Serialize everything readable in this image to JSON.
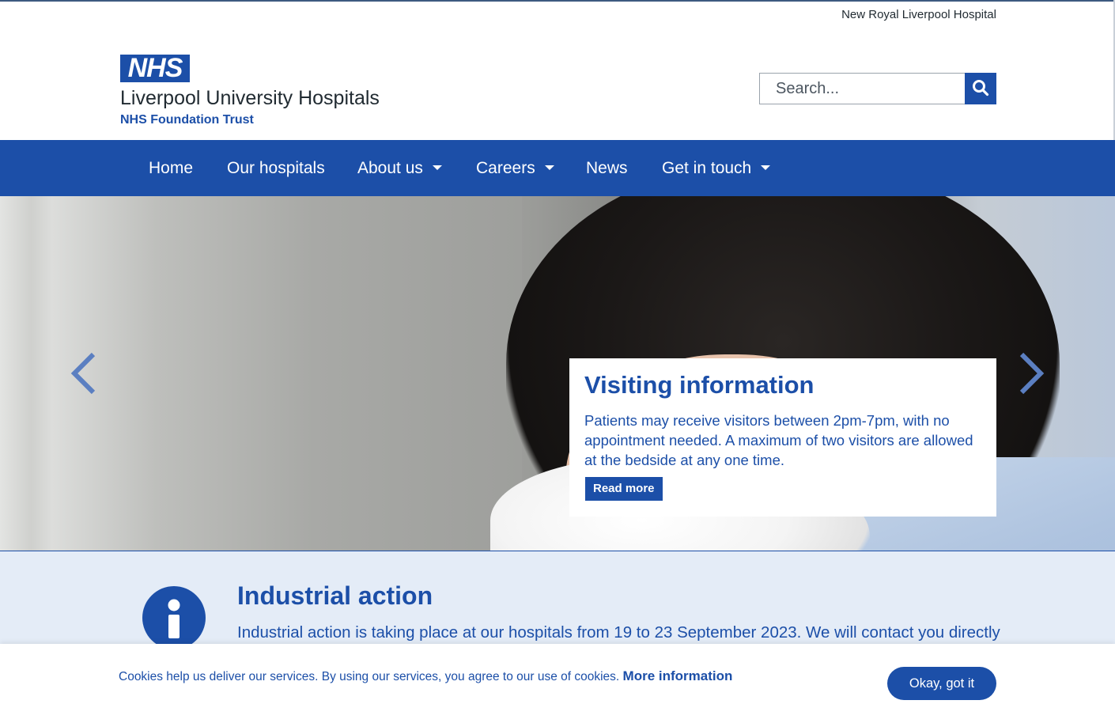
{
  "topbar": {
    "site_link": "New Royal Liverpool Hospital"
  },
  "logo": {
    "nhs": "NHS",
    "name": "Liverpool University Hospitals",
    "sub": "NHS Foundation Trust"
  },
  "search": {
    "placeholder": "Search..."
  },
  "nav": {
    "items": [
      {
        "label": "Home",
        "dropdown": false
      },
      {
        "label": "Our hospitals",
        "dropdown": false
      },
      {
        "label": "About us",
        "dropdown": true
      },
      {
        "label": "Careers",
        "dropdown": true
      },
      {
        "label": "News",
        "dropdown": false
      },
      {
        "label": "Get in touch",
        "dropdown": true
      }
    ]
  },
  "hero": {
    "title": "Visiting information",
    "text": "Patients may receive visitors between 2pm-7pm, with no appointment needed. A maximum of two visitors are allowed at the bedside at any one time.",
    "button": "Read more",
    "image_icon": "woman-sneezing-into-tissue-photo"
  },
  "alert": {
    "icon": "info-icon",
    "title": "Industrial action",
    "text": "Industrial action is taking place at our hospitals from 19 to 23 September 2023. We will contact you directly"
  },
  "cookie": {
    "text": "Cookies help us deliver our services. By using our services, you agree to our use of cookies.",
    "link": "More information",
    "button": "Okay, got it"
  },
  "colors": {
    "brand": "#1c4fa8",
    "alert_bg": "#e4ecf7",
    "text": "#212b32"
  }
}
